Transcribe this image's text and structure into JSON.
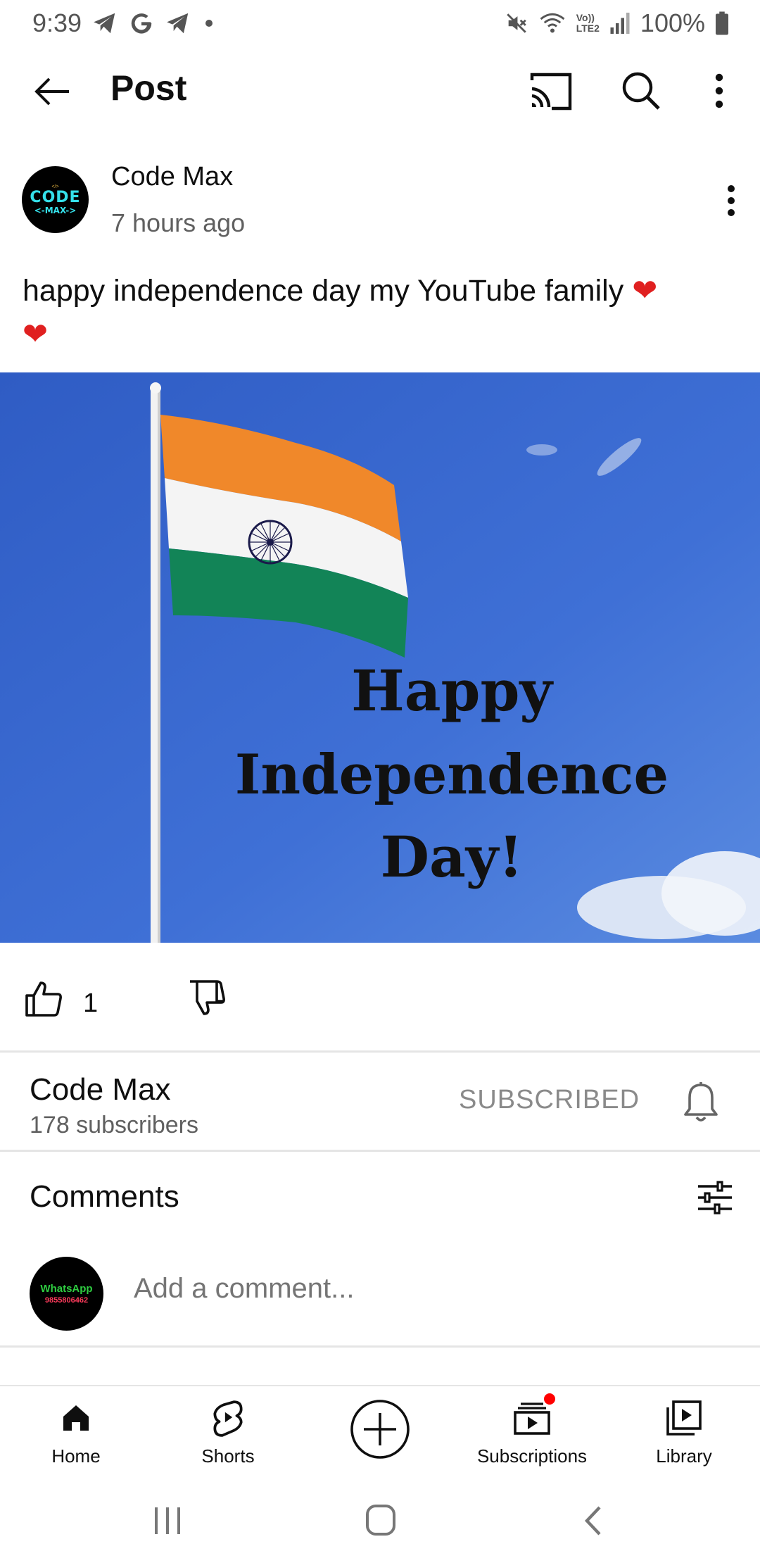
{
  "status_bar": {
    "time": "9:39",
    "battery": "100%",
    "network_label": "LTE2",
    "volte_label": "Vo))"
  },
  "app_bar": {
    "title": "Post"
  },
  "post": {
    "channel_name": "Code Max",
    "time_ago": "7 hours ago",
    "text": "happy independence day my YouTube family",
    "heart_1": "❤",
    "heart_2": "❤",
    "avatar_text_top": "CODE",
    "avatar_text_bottom": "<-MAX->",
    "image_text": [
      "Happy",
      "Independence",
      "Day!"
    ]
  },
  "actions": {
    "like_count": "1"
  },
  "channel": {
    "name": "Code Max",
    "subscribers": "178 subscribers",
    "subscribe_state": "SUBSCRIBED"
  },
  "comments": {
    "title": "Comments",
    "placeholder": "Add a comment...",
    "avatar_line1": "WhatsApp",
    "avatar_line2": "9855806462"
  },
  "bottom_nav": {
    "items": [
      {
        "label": "Home",
        "icon": "home-icon"
      },
      {
        "label": "Shorts",
        "icon": "shorts-icon"
      },
      {
        "label": "",
        "icon": "create-icon"
      },
      {
        "label": "Subscriptions",
        "icon": "subscriptions-icon"
      },
      {
        "label": "Library",
        "icon": "library-icon"
      }
    ]
  },
  "colors": {
    "accent_red": "#ff0000",
    "heart": "#e02020",
    "sky": "#3f6fd1",
    "saffron": "#f08a2c",
    "green": "#138058",
    "chakra": "#1a1a4a"
  }
}
